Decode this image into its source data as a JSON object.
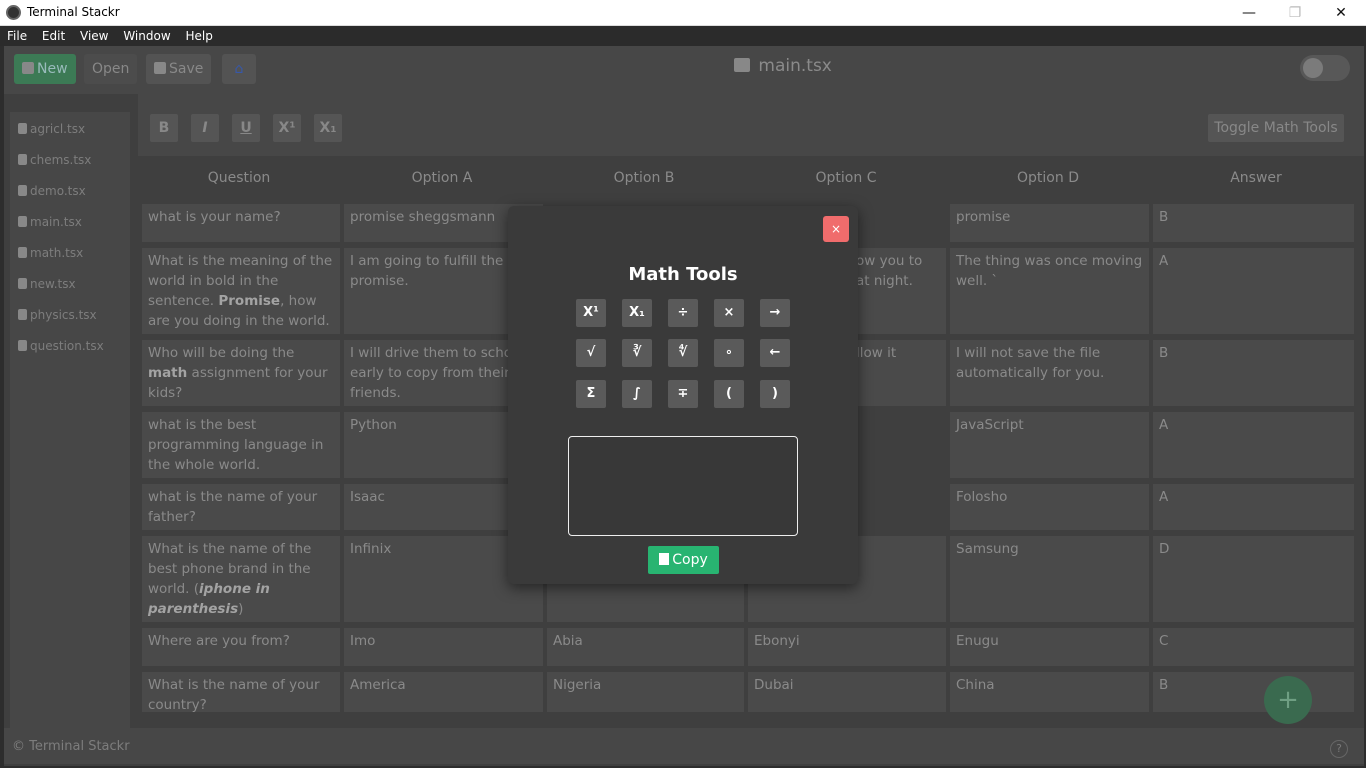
{
  "window": {
    "title": "Terminal Stackr"
  },
  "menu": [
    "File",
    "Edit",
    "View",
    "Window",
    "Help"
  ],
  "toolbar": {
    "new_label": "New",
    "open_label": "Open",
    "save_label": "Save",
    "doc_title": "main.tsx"
  },
  "sidebar": {
    "files": [
      "agricl.tsx",
      "chems.tsx",
      "demo.tsx",
      "main.tsx",
      "math.tsx",
      "new.tsx",
      "physics.tsx",
      "question.tsx"
    ]
  },
  "format": {
    "bold": "B",
    "italic": "I",
    "underline": "U",
    "superscript": "X¹",
    "subscript": "X₁",
    "toggle_math": "Toggle Math Tools"
  },
  "table": {
    "headers": [
      "Question",
      "Option A",
      "Option B",
      "Option C",
      "Option D",
      "Answer"
    ],
    "rows": [
      {
        "q": "what is your name?",
        "a": "promise sheggsmann",
        "b": "",
        "c": "",
        "d": "promise",
        "ans": "B"
      },
      {
        "q": "What is the meaning of the world in bold in the sentence. Promise, how are you doing in the world.",
        "a": "I am going to fulfill the promise.",
        "b": "",
        "c": "ow you to at night.",
        "d": "The thing was once moving well. `",
        "ans": "A"
      },
      {
        "q": "Who will be doing the math assignment for your kids?",
        "a": "I will drive them to schoo early to copy from their friends.",
        "b": "",
        "c": "llow it",
        "d": "I will not save the file automatically for you.",
        "ans": "B"
      },
      {
        "q": "what is the best programming language in the whole world.",
        "a": "Python",
        "b": "",
        "c": "",
        "d": "JavaScript",
        "ans": "A"
      },
      {
        "q": "what is the name of your father?",
        "a": "Isaac",
        "b": "",
        "c": "",
        "d": "Folosho",
        "ans": "A"
      },
      {
        "q": "What is the name of the best phone brand in the world. (iphone in parenthesis)",
        "a": "Infinix",
        "b": "",
        "c": "",
        "d": "Samsung",
        "ans": "D"
      },
      {
        "q": "Where are you from?",
        "a": "Imo",
        "b": "Abia",
        "c": "Ebonyi",
        "d": "Enugu",
        "ans": "C"
      },
      {
        "q": "What is the name of your country?",
        "a": "America",
        "b": "Nigeria",
        "c": "Dubai",
        "d": "China",
        "ans": "B"
      }
    ]
  },
  "footer": {
    "brand": "Terminal Stackr",
    "help": "?"
  },
  "fab": "+",
  "modal": {
    "title": "Math Tools",
    "close": "×",
    "buttons": [
      "X¹",
      "X₁",
      "÷",
      "×",
      "→",
      "√",
      "∛",
      "∜",
      "∘",
      "←",
      "Σ",
      "∫",
      "∓",
      "(",
      ")"
    ],
    "copy_label": "Copy",
    "text_value": ""
  }
}
